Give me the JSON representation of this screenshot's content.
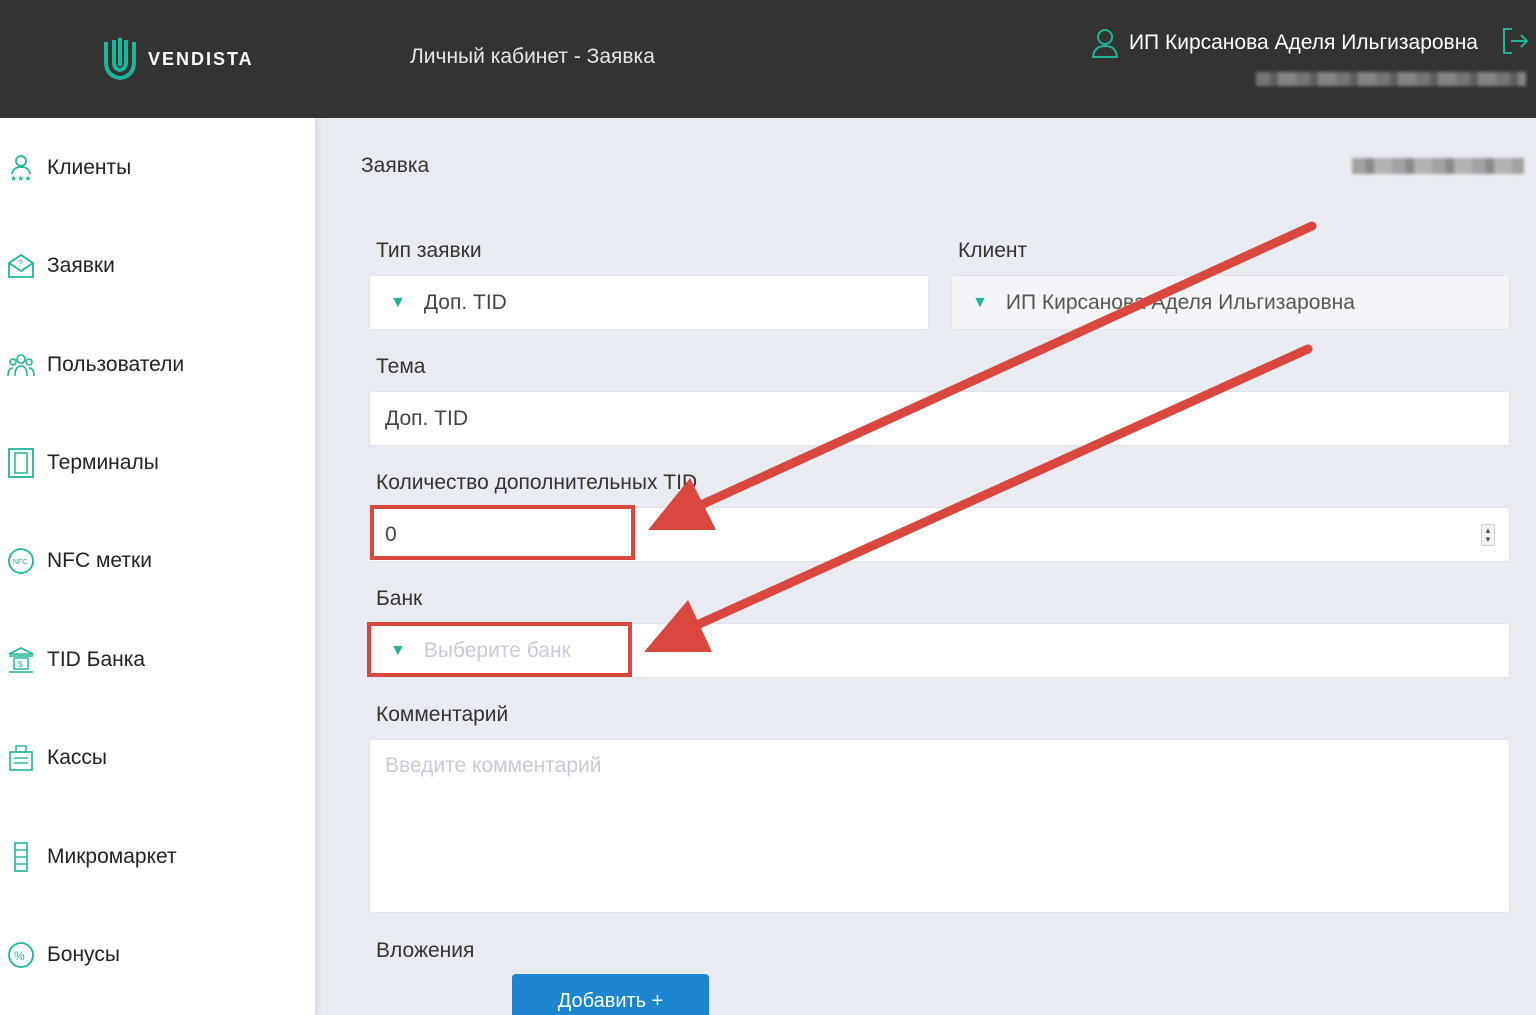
{
  "header": {
    "brand": "VENDISTA",
    "page_heading": "Личный кабинет - Заявка",
    "user_name": "ИП Кирсанова Аделя Ильгизаровна"
  },
  "sidebar": {
    "items": [
      {
        "label": "Клиенты",
        "icon": "clients-icon"
      },
      {
        "label": "Заявки",
        "icon": "envelope-question-icon"
      },
      {
        "label": "Пользователи",
        "icon": "users-group-icon"
      },
      {
        "label": "Терминалы",
        "icon": "terminal-icon"
      },
      {
        "label": "NFC метки",
        "icon": "nfc-icon"
      },
      {
        "label": "TID Банка",
        "icon": "bank-icon"
      },
      {
        "label": "Кассы",
        "icon": "cash-register-icon"
      },
      {
        "label": "Микромаркет",
        "icon": "micromarket-icon"
      },
      {
        "label": "Бонусы",
        "icon": "percent-icon"
      }
    ]
  },
  "content": {
    "title": "Заявка"
  },
  "form": {
    "request_type": {
      "label": "Тип заявки",
      "value": "Доп. TID"
    },
    "client": {
      "label": "Клиент",
      "value": "ИП Кирсанова Аделя Ильгизаровна"
    },
    "topic": {
      "label": "Тема",
      "value": "Доп. TID"
    },
    "tid_count": {
      "label": "Количество дополнительных TID",
      "value": "0"
    },
    "bank": {
      "label": "Банк",
      "placeholder": "Выберите банк"
    },
    "comment": {
      "label": "Комментарий",
      "placeholder": "Введите комментарий"
    },
    "attachments": {
      "label": "Вложения",
      "add_button": "Добавить +"
    }
  },
  "colors": {
    "topbar": "#333333",
    "accent_teal": "#1fb59a",
    "button_blue": "#1c86d0",
    "annotation_red": "#d9473f"
  }
}
